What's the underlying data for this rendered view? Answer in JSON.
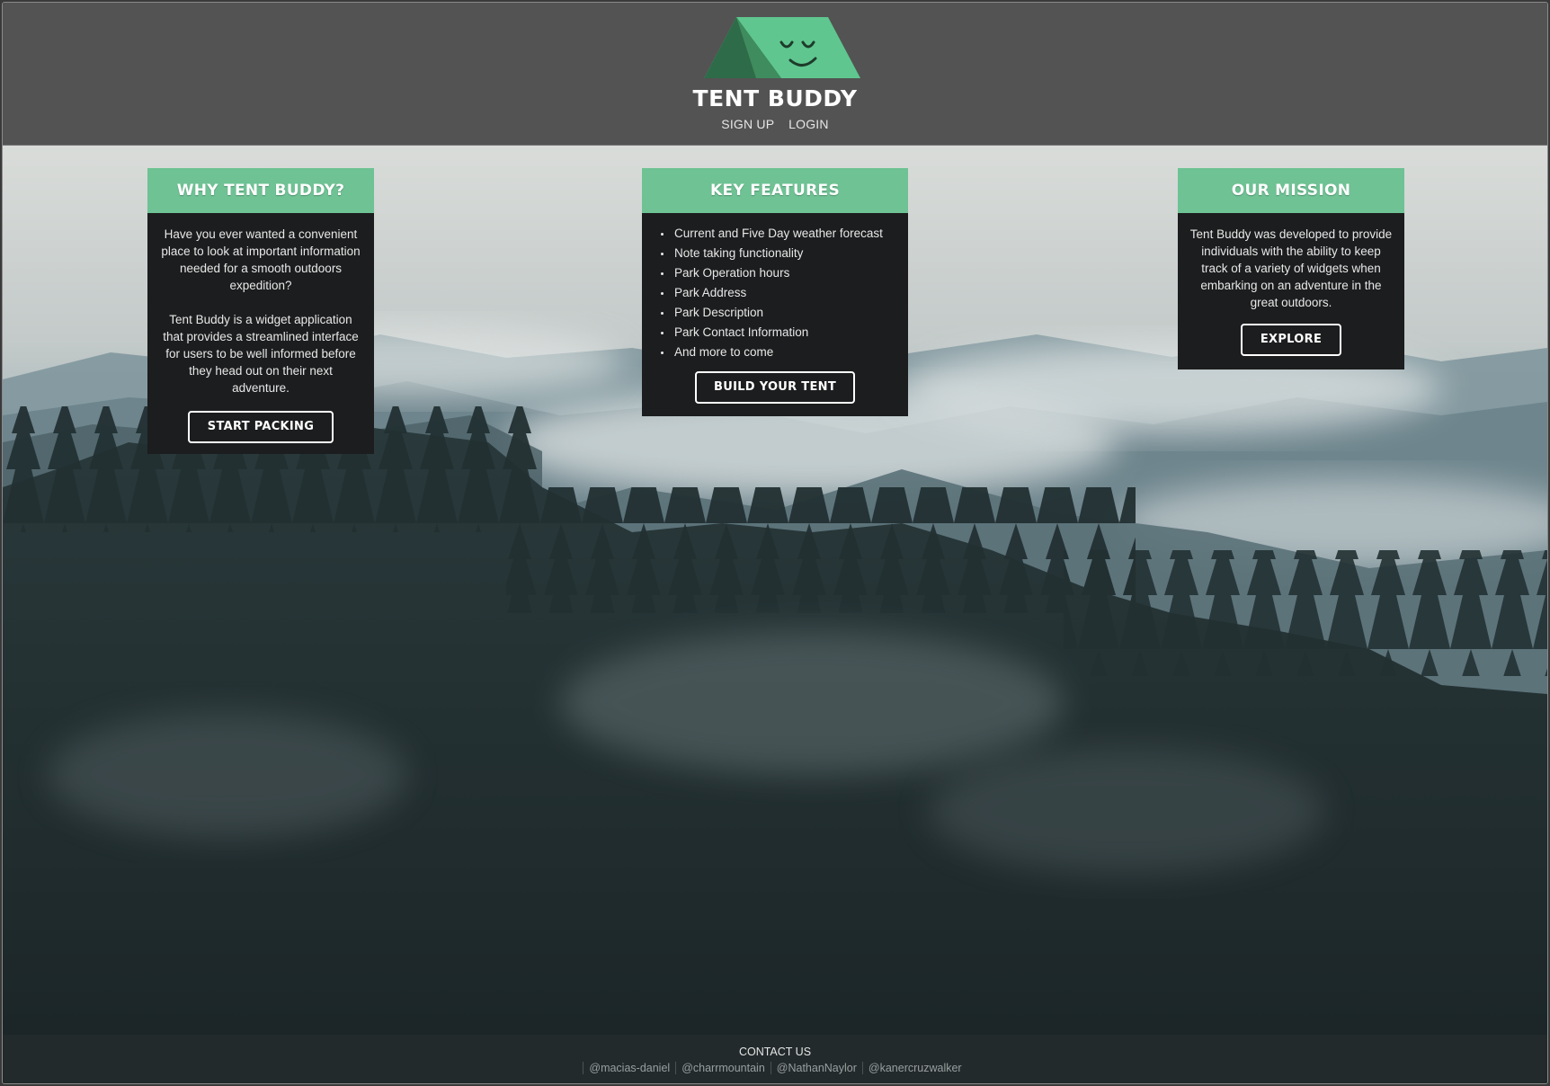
{
  "header": {
    "brand": "TENT BUDDY",
    "logo_icon": "tent-smiley-icon",
    "nav": [
      {
        "label": "SIGN UP"
      },
      {
        "label": "LOGIN"
      }
    ],
    "background_color": "#535353"
  },
  "colors": {
    "accent": "#6ec294",
    "card_body": "#1c1d1e",
    "tent_light": "#5fc68f",
    "tent_dark": "#2e6b48"
  },
  "cards": [
    {
      "title": "WHY TENT BUDDY?",
      "paragraphs": [
        "Have you ever wanted a convenient place to look at important information needed for a smooth outdoors expedition?",
        "Tent Buddy is a widget application that provides a streamlined interface for users to be well informed before they head out on their next adventure."
      ],
      "button": "START PACKING"
    },
    {
      "title": "KEY FEATURES",
      "features": [
        "Current and Five Day weather forecast",
        "Note taking functionality",
        "Park Operation hours",
        "Park Address",
        "Park Description",
        "Park Contact Information",
        "And more to come"
      ],
      "button": "BUILD YOUR TENT"
    },
    {
      "title": "OUR MISSION",
      "paragraphs": [
        "Tent Buddy was developed to provide individuals with the ability to keep track of a variety of widgets when embarking on an adventure in the great outdoors."
      ],
      "button": "EXPLORE"
    }
  ],
  "footer": {
    "title": "CONTACT US",
    "links": [
      "@macias-daniel",
      "@charrmountain",
      "@NathanNaylor",
      "@kanercruzwalker"
    ]
  }
}
